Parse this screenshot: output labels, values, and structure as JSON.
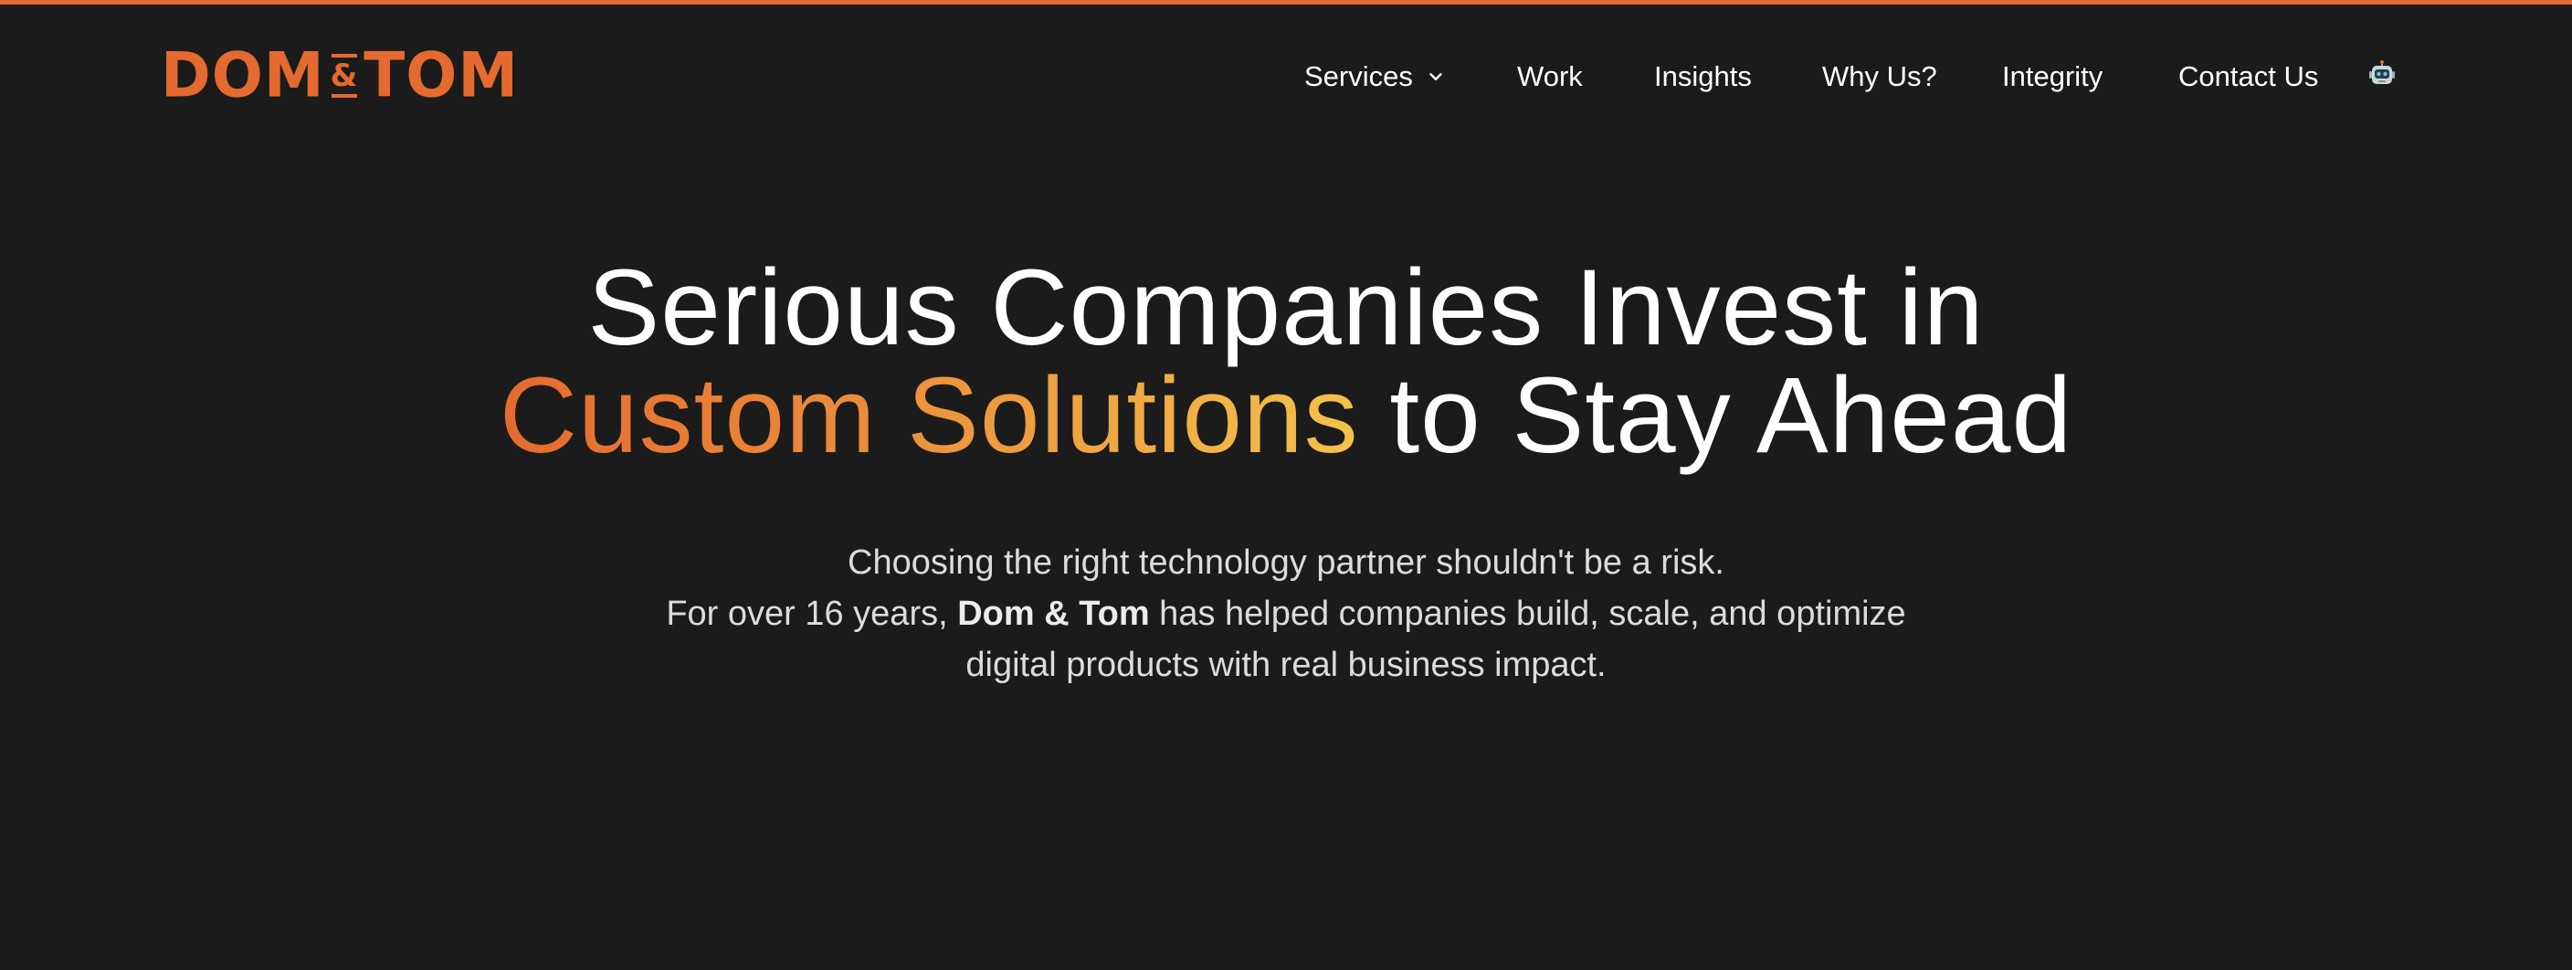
{
  "brand": {
    "logo_left": "DOM",
    "logo_amp": "&",
    "logo_right": "TOM",
    "accent_color": "#e46a2f",
    "background_color": "#1b1b1b"
  },
  "nav": {
    "items": [
      {
        "label": "Services",
        "has_dropdown": true,
        "icon": "chevron-down-icon"
      },
      {
        "label": "Work"
      },
      {
        "label": "Insights"
      },
      {
        "label": "Why Us?"
      },
      {
        "label": "Integrity"
      },
      {
        "label": "Contact Us"
      }
    ],
    "robot_icon": "robot-icon"
  },
  "hero": {
    "title_line1": "Serious Companies Invest in",
    "title_accent": "Custom Solutions",
    "title_line2_rest": " to Stay Ahead",
    "subtitle_line1": "Choosing the right technology partner shouldn't be a risk.",
    "subtitle_line2_prefix": "For over 16 years, ",
    "subtitle_line2_brand": "Dom & Tom",
    "subtitle_line2_suffix": " has helped companies build, scale, and optimize",
    "subtitle_line3": "digital products with real business impact.",
    "gradient_start": "#e46a2f",
    "gradient_end": "#f3c24b"
  }
}
